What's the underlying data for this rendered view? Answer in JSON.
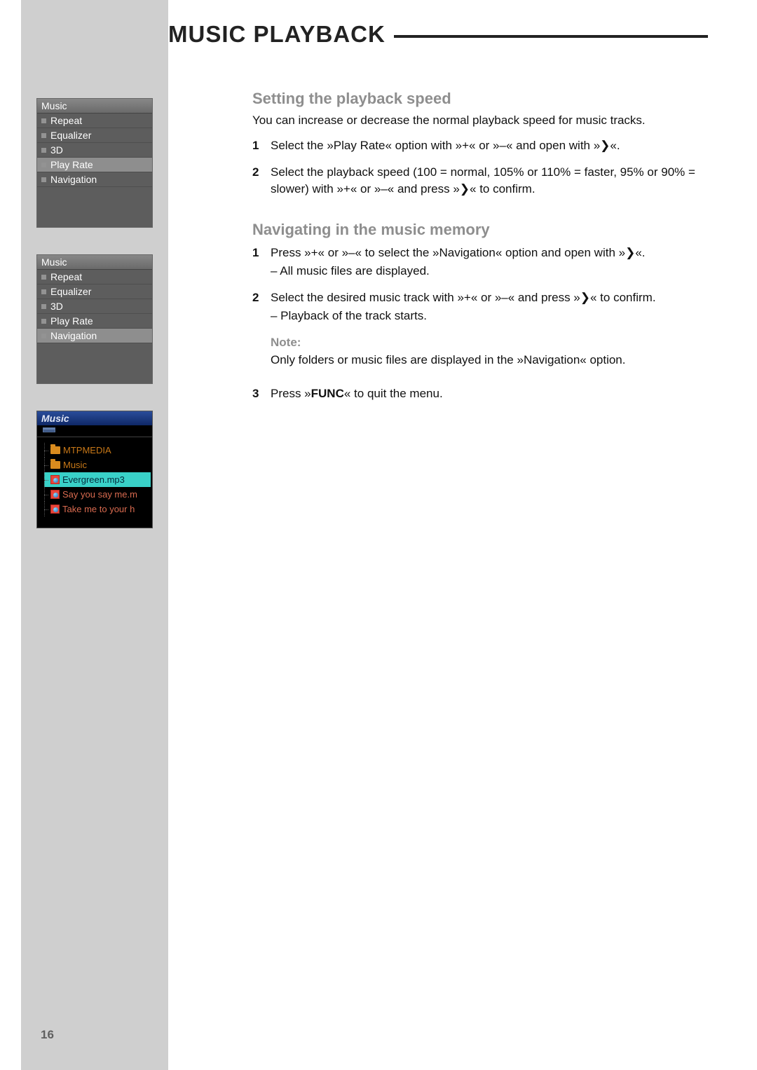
{
  "title": "MUSIC PLAYBACK",
  "pageNumber": "16",
  "sidebar": {
    "menu1": {
      "header": "Music",
      "items": [
        "Repeat",
        "Equalizer",
        "3D",
        "Play Rate",
        "Navigation"
      ],
      "selectedIndex": 3
    },
    "menu2": {
      "header": "Music",
      "items": [
        "Repeat",
        "Equalizer",
        "3D",
        "Play Rate",
        "Navigation"
      ],
      "selectedIndex": 4
    },
    "device": {
      "title": "Music",
      "rows": [
        {
          "type": "folder",
          "label": "MTPMEDIA"
        },
        {
          "type": "folder",
          "label": "Music"
        },
        {
          "type": "file",
          "label": "Evergreen.mp3",
          "selected": true
        },
        {
          "type": "file",
          "label": "Say you say me.m"
        },
        {
          "type": "file",
          "label": "Take me to your h"
        }
      ]
    }
  },
  "section1": {
    "heading": "Setting the playback speed",
    "intro": "You can increase or decrease the normal playback speed for music tracks.",
    "step1_num": "1",
    "step1_text": "Select the »Play Rate« option with »+« or »–« and open with »❯«.",
    "step2_num": "2",
    "step2_text": "Select the playback speed (100 = normal, 105% or 110% = faster, 95% or 90% = slower) with »+« or »–« and press »❯« to confirm."
  },
  "section2": {
    "heading": "Navigating in the music memory",
    "step1_num": "1",
    "step1_text": "Press »+« or »–« to select the »Navigation« option and open with »❯«.",
    "step1_sub": "– All music files are displayed.",
    "step2_num": "2",
    "step2_text": "Select the desired music track with »+« or »–« and press »❯« to confirm.",
    "step2_sub": "– Playback of the track starts.",
    "note_label": "Note:",
    "note_body": "Only folders or music files are displayed in the »Navigation« option.",
    "step3_num": "3",
    "step3_pre": "Press »",
    "step3_func": "FUNC",
    "step3_post": "« to quit the menu."
  }
}
